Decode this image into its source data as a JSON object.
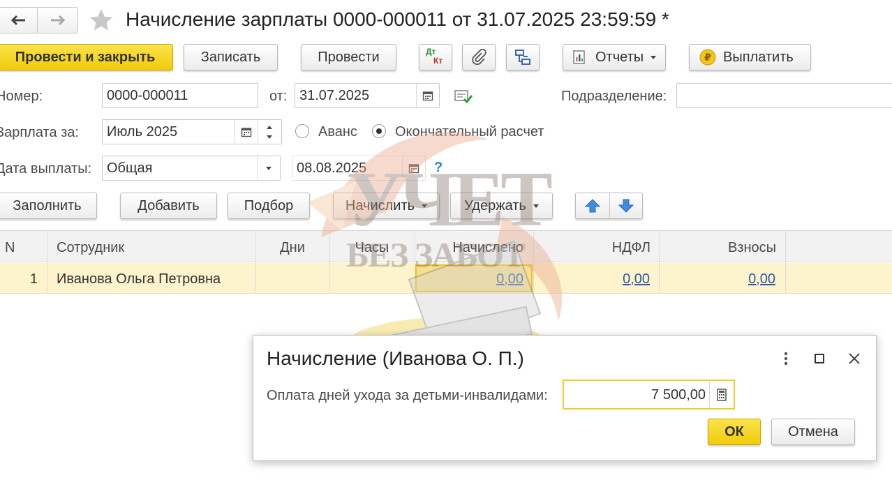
{
  "title": "Начисление зарплаты 0000-000011 от 31.07.2025 23:59:59 *",
  "toolbar": {
    "post_close": "Провести и закрыть",
    "save": "Записать",
    "post": "Провести",
    "dtkt_top": "Дт",
    "dtkt_bottom": "Кт",
    "reports": "Отчеты",
    "pay": "Выплатить"
  },
  "form": {
    "number_label": "Номер:",
    "number_value": "0000-000011",
    "from_label": "от:",
    "date_value": "31.07.2025",
    "subdivision_label": "Подразделение:",
    "subdivision_value": "",
    "salary_label": "Зарплата за:",
    "salary_value": "Июль 2025",
    "advance_label": "Аванс",
    "final_label": "Окончательный расчет",
    "payday_label": "Дата выплаты:",
    "payday_type": "Общая",
    "payday_date": "08.08.2025",
    "help": "?"
  },
  "actions": {
    "fill": "Заполнить",
    "add": "Добавить",
    "select": "Подбор",
    "accrue": "Начислить",
    "withhold": "Удержать"
  },
  "table": {
    "columns": [
      "N",
      "Сотрудник",
      "Дни",
      "Часы",
      "Начислено",
      "НДФЛ",
      "Взносы"
    ],
    "rows": [
      {
        "n": "1",
        "employee": "Иванова Ольга Петровна",
        "days": "",
        "hours": "",
        "accrued": "0,00",
        "ndfl": "0,00",
        "contributions": "0,00"
      }
    ]
  },
  "watermark": {
    "line1": "УЧЕТ",
    "line2": "БЕЗ ЗАБОТ"
  },
  "dialog": {
    "title": "Начисление (Иванова О. П.)",
    "field_label": "Оплата дней ухода за детьми-инвалидами:",
    "field_value": "7 500,00",
    "ok": "ОК",
    "cancel": "Отмена"
  },
  "colors": {
    "accent_yellow": "#f5d21f",
    "row_highlight": "#fdf3cc",
    "link": "#2a5aa8",
    "arrow_blue": "#3d8de0"
  }
}
